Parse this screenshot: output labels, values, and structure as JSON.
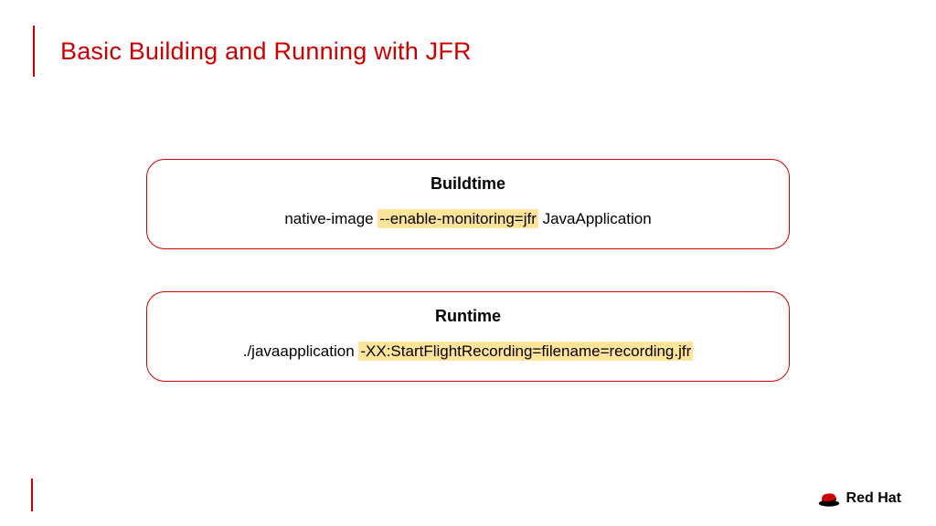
{
  "title": "Basic Building and Running with JFR",
  "cards": {
    "buildtime": {
      "heading": "Buildtime",
      "cmd_prefix": "native-image ",
      "cmd_highlight": "--enable-monitoring=jfr",
      "cmd_suffix": " JavaApplication"
    },
    "runtime": {
      "heading": "Runtime",
      "cmd_prefix": "./javaapplication ",
      "cmd_highlight": "-XX:StartFlightRecording=filename=recording.jfr",
      "cmd_suffix": ""
    }
  },
  "brand": "Red Hat",
  "colors": {
    "accent": "#cc0000",
    "highlight": "#ffe49a"
  }
}
